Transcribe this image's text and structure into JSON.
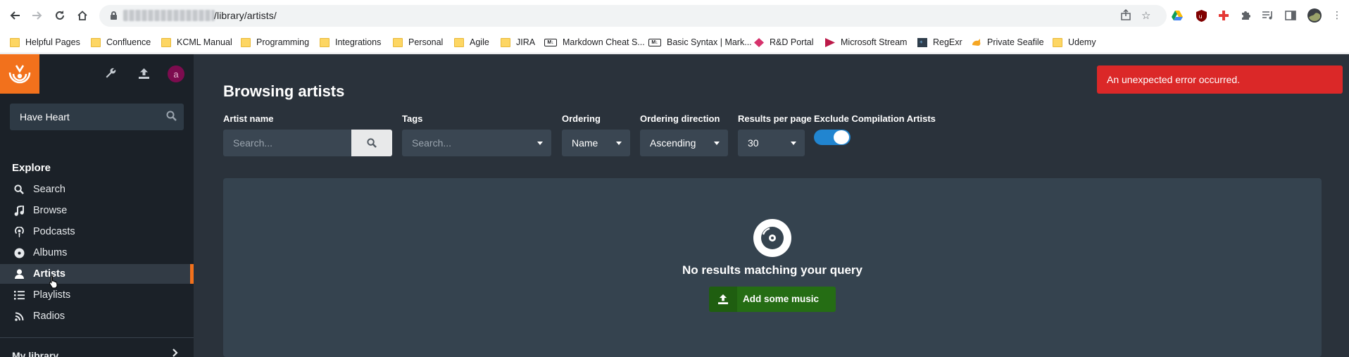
{
  "browser": {
    "url_path": "/library/artists/",
    "nav": {
      "back": "back-icon",
      "forward": "forward-icon",
      "reload": "reload-icon",
      "home": "home-icon"
    }
  },
  "bookmarks": [
    {
      "label": "Helpful Pages",
      "icon": "folder-icon"
    },
    {
      "label": "Confluence",
      "icon": "folder-icon"
    },
    {
      "label": "KCML Manual",
      "icon": "folder-icon"
    },
    {
      "label": "Programming",
      "icon": "folder-icon"
    },
    {
      "label": "Integrations",
      "icon": "folder-icon"
    },
    {
      "label": "Personal",
      "icon": "folder-icon"
    },
    {
      "label": "Agile",
      "icon": "folder-icon"
    },
    {
      "label": "JIRA",
      "icon": "folder-icon"
    },
    {
      "label": "Markdown Cheat S...",
      "icon": "markdown-icon"
    },
    {
      "label": "Basic Syntax | Mark...",
      "icon": "markdown-icon"
    },
    {
      "label": "R&D Portal",
      "icon": "portal-icon"
    },
    {
      "label": "Microsoft Stream",
      "icon": "stream-icon"
    },
    {
      "label": "RegExr",
      "icon": "regexr-icon"
    },
    {
      "label": "Private Seafile",
      "icon": "seafile-icon"
    },
    {
      "label": "Udemy",
      "icon": "folder-icon"
    }
  ],
  "sidebar": {
    "avatar_letter": "a",
    "search_value": "Have Heart",
    "explore_heading": "Explore",
    "items": [
      {
        "label": "Search",
        "icon": "search-icon"
      },
      {
        "label": "Browse",
        "icon": "music-note-icon"
      },
      {
        "label": "Podcasts",
        "icon": "podcast-icon"
      },
      {
        "label": "Albums",
        "icon": "album-icon"
      },
      {
        "label": "Artists",
        "icon": "user-icon",
        "active": true
      },
      {
        "label": "Playlists",
        "icon": "list-icon"
      },
      {
        "label": "Radios",
        "icon": "rss-icon"
      }
    ],
    "my_library": "My library"
  },
  "main": {
    "title": "Browsing artists",
    "filters": {
      "artist_name_label": "Artist name",
      "artist_name_placeholder": "Search...",
      "tags_label": "Tags",
      "tags_placeholder": "Search...",
      "ordering_label": "Ordering",
      "ordering_value": "Name",
      "direction_label": "Ordering direction",
      "direction_value": "Ascending",
      "per_page_label": "Results per page",
      "per_page_value": "30",
      "exclude_label": "Exclude Compilation Artists",
      "exclude_on": true
    },
    "empty_state": {
      "message": "No results matching your query",
      "button": "Add some music"
    }
  },
  "toast": {
    "message": "An unexpected error occurred."
  },
  "colors": {
    "accent": "#f2711c",
    "sidebar_bg": "#1b2128",
    "main_bg": "#2a323b",
    "error": "#db2828",
    "success": "#256d14",
    "toggle": "#2185d0"
  }
}
